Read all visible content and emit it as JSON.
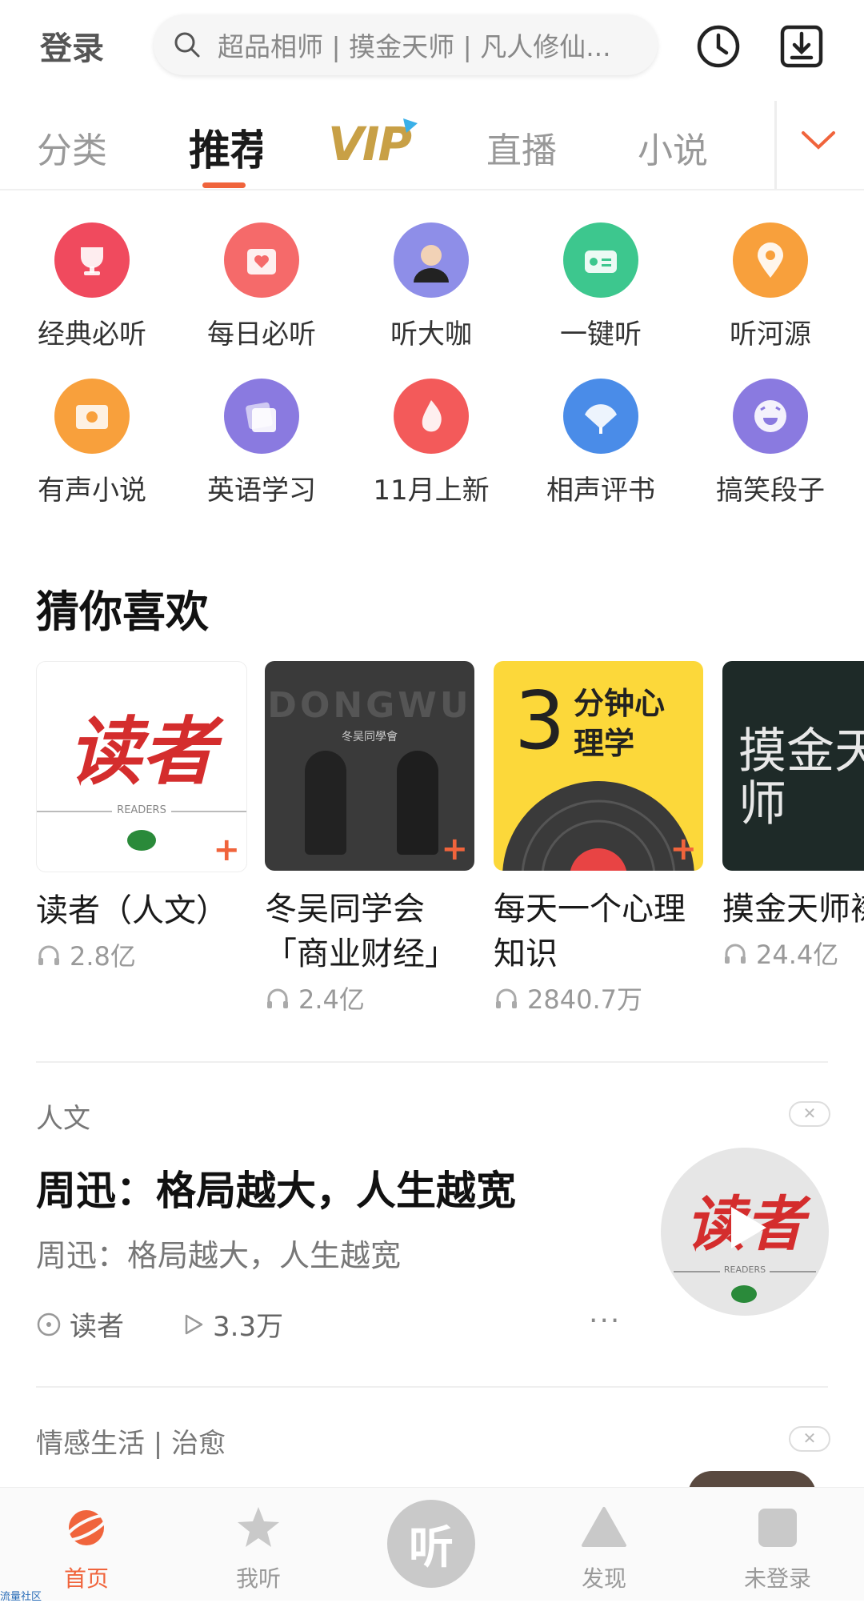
{
  "header": {
    "login_label": "登录",
    "search_placeholder": "超品相师 | 摸金天师 | 凡人修仙...",
    "history_icon": "clock-icon",
    "download_icon": "download-icon"
  },
  "tabs": [
    {
      "label": "分类"
    },
    {
      "label": "推荐"
    },
    {
      "label": "VIP"
    },
    {
      "label": "直播"
    },
    {
      "label": "小说"
    }
  ],
  "tabs_more_icon": "chevron-down-icon",
  "categories": [
    {
      "label": "经典必听",
      "icon": "trophy-icon",
      "color": "#f04a5e"
    },
    {
      "label": "每日必听",
      "icon": "calendar-heart-icon",
      "color": "#f56a6a"
    },
    {
      "label": "听大咖",
      "icon": "avatar-icon",
      "color": "#8e8ee8"
    },
    {
      "label": "一键听",
      "icon": "radio-icon",
      "color": "#3dc78e"
    },
    {
      "label": "听河源",
      "icon": "location-pin-icon",
      "color": "#f8a03c"
    },
    {
      "label": "有声小说",
      "icon": "book-icon",
      "color": "#f8a03c"
    },
    {
      "label": "英语学习",
      "icon": "english-card-icon",
      "color": "#8a7ae0"
    },
    {
      "label": "11月上新",
      "icon": "flame-icon",
      "color": "#f35a5a"
    },
    {
      "label": "相声评书",
      "icon": "fan-icon",
      "color": "#4a8ce8"
    },
    {
      "label": "搞笑段子",
      "icon": "laugh-face-icon",
      "color": "#8a7ae0"
    }
  ],
  "recommend": {
    "title": "猜你喜欢",
    "items": [
      {
        "name": "读者（人文）",
        "plays": "2.8亿",
        "cover_text": "读者",
        "cover_sub": "READERS"
      },
      {
        "name": "冬吴同学会「商业财经」",
        "plays": "2.4亿",
        "cover_text": "DONGWU",
        "cover_sub": "冬吴同學會"
      },
      {
        "name": "每天一个心理知识",
        "plays": "2840.7万",
        "cover_text": "3",
        "cover_sub": "分钟心理学"
      },
      {
        "name": "摸金天师襟）「悬疑",
        "plays": "24.4亿",
        "cover_text": "摸金天师",
        "cover_sub": ""
      }
    ]
  },
  "feed": [
    {
      "tag": "人文",
      "title": "周迅：格局越大，人生越宽",
      "subtitle": "周迅：格局越大，人生越宽",
      "author": "读者",
      "plays": "3.3万",
      "more": "···",
      "cover_text": "读者",
      "cover_sub": "READERS"
    },
    {
      "tag": "情感生活 | 治愈"
    }
  ],
  "close_label": "✕",
  "bottom_nav": [
    {
      "label": "首页",
      "icon": "planet-icon",
      "active": true
    },
    {
      "label": "我听",
      "icon": "star-icon",
      "active": false
    },
    {
      "label": "听",
      "icon": "listen-icon",
      "active": false
    },
    {
      "label": "发现",
      "icon": "triangle-icon",
      "active": false
    },
    {
      "label": "未登录",
      "icon": "user-square-icon",
      "active": false
    }
  ],
  "watermark": "流量社区",
  "colors": {
    "accent": "#f0643c",
    "vip": "#c8a046"
  }
}
